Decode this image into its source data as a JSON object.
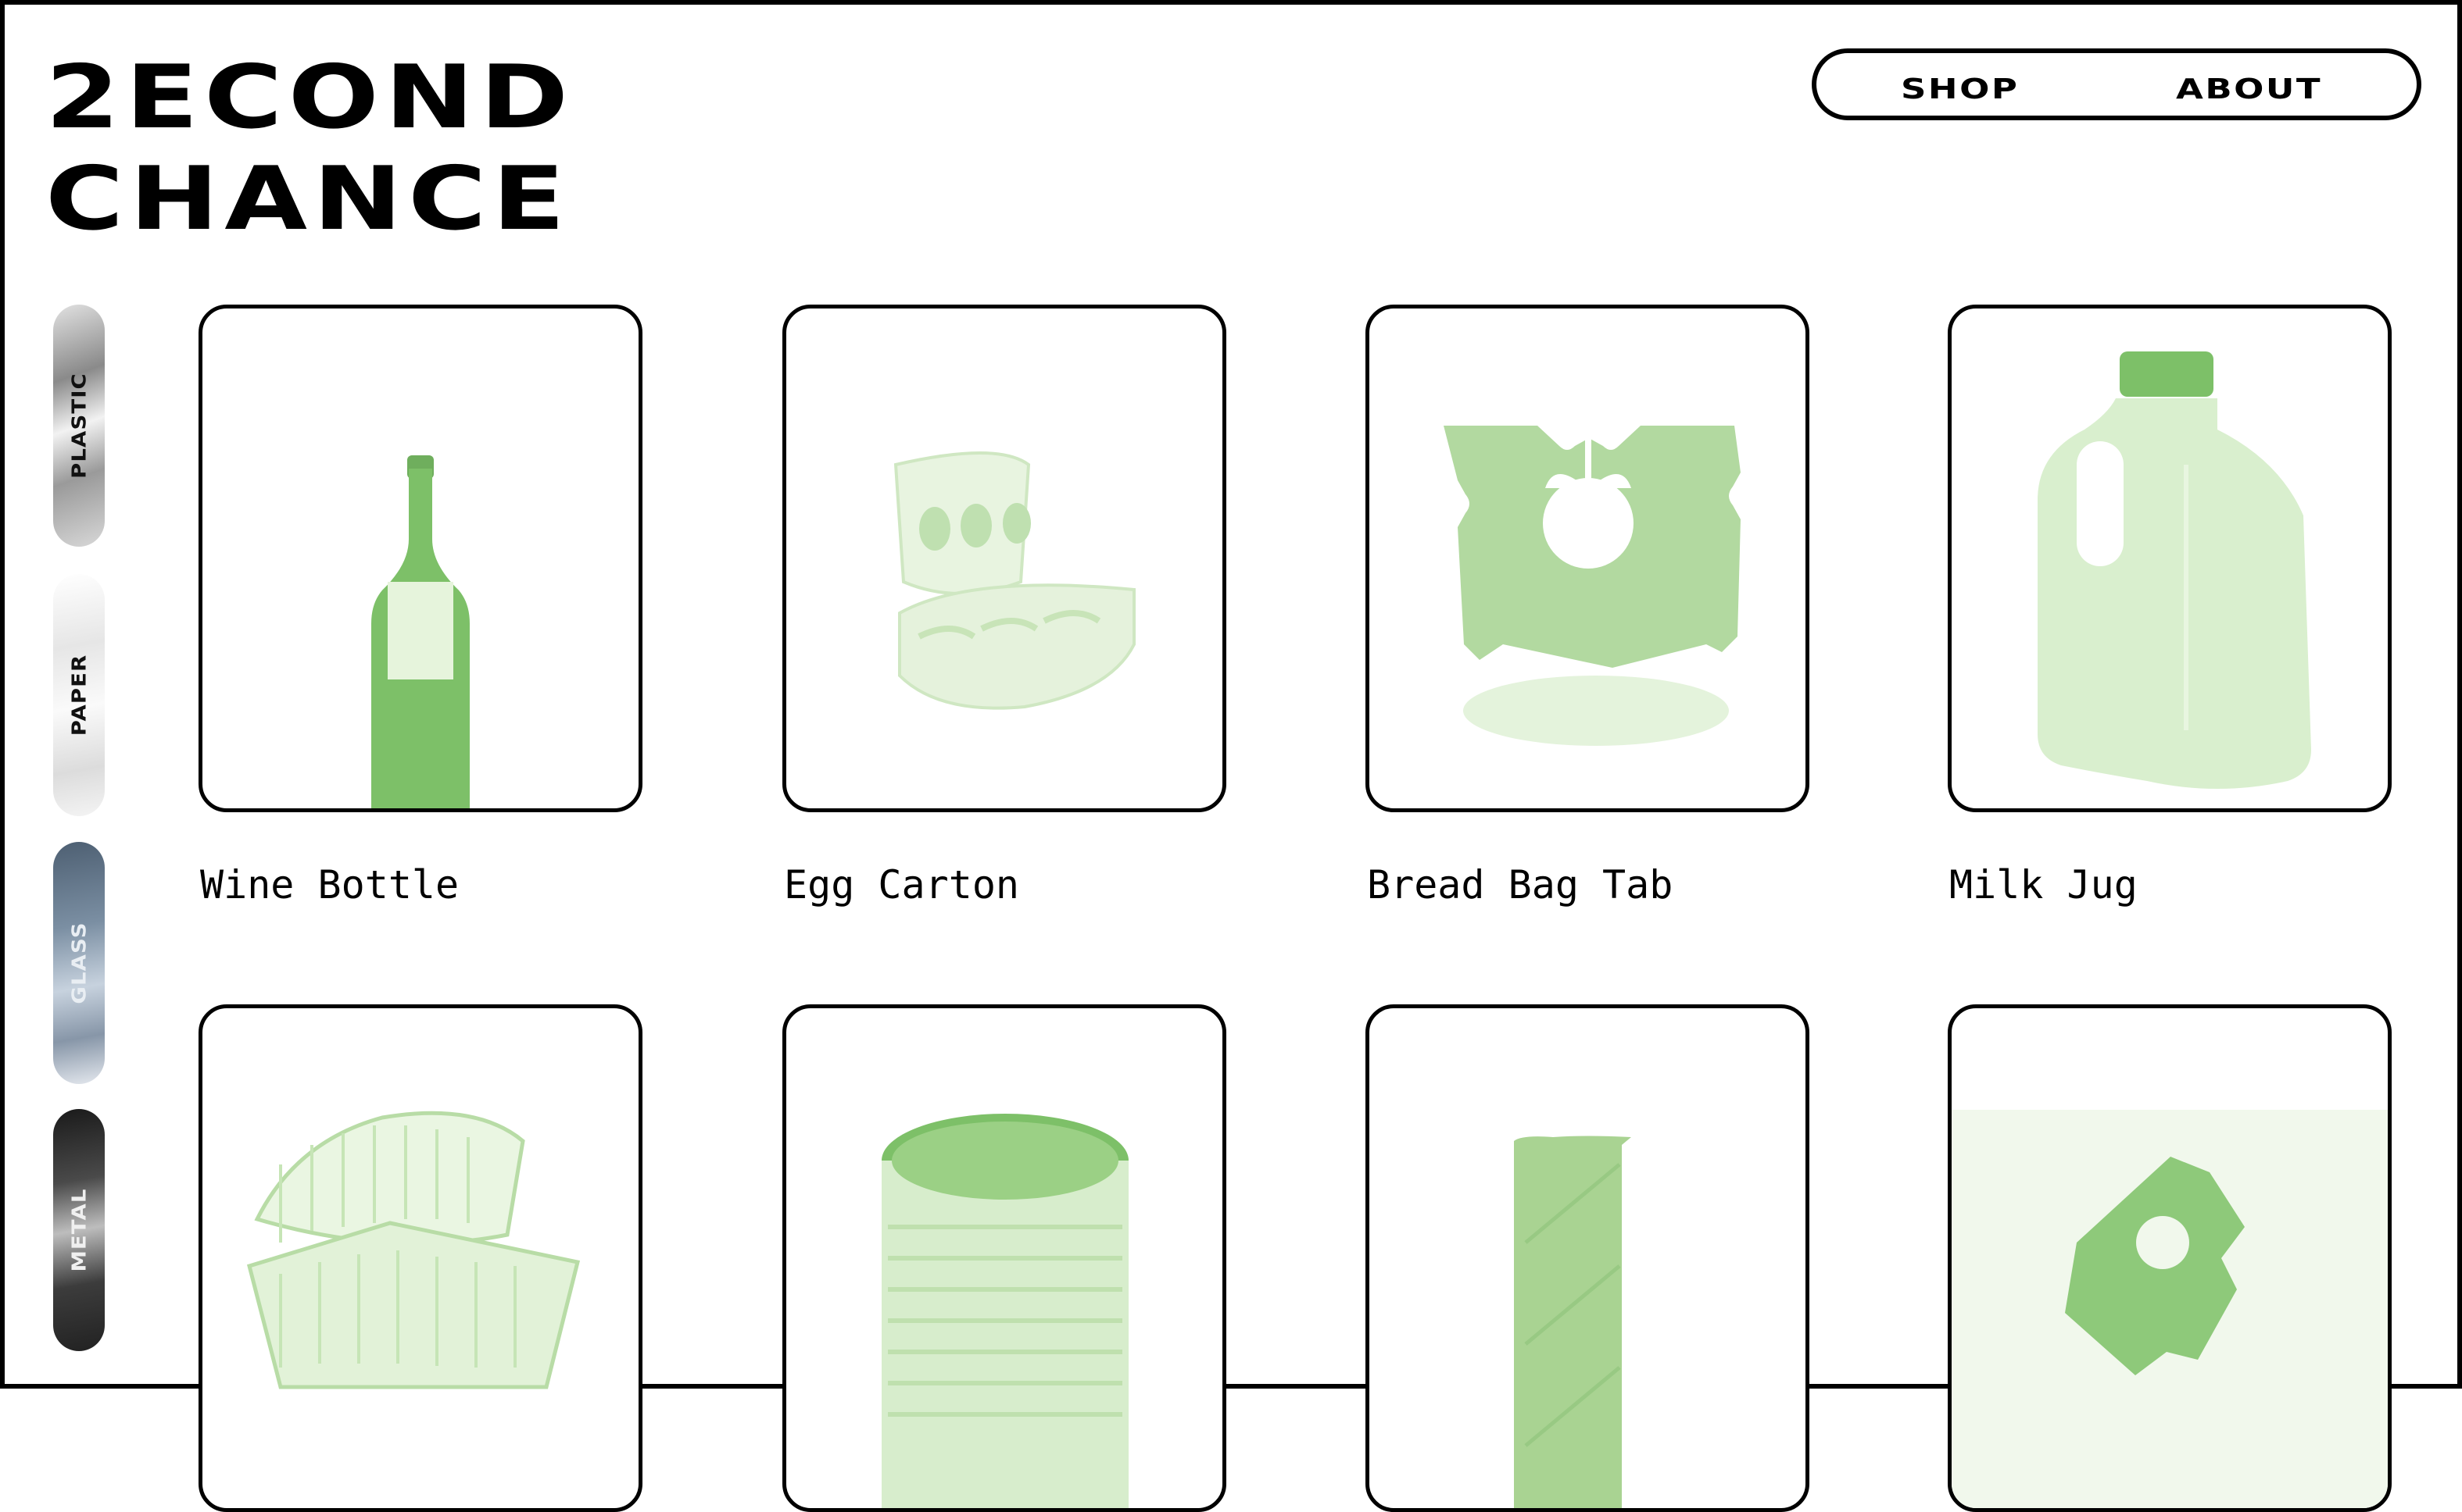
{
  "brand": {
    "line1": "2ECOND",
    "line2": "CHANCE"
  },
  "nav": {
    "shop": "SHOP",
    "about": "ABOUT"
  },
  "categories": [
    {
      "label": "PLASTIC"
    },
    {
      "label": "PAPER"
    },
    {
      "label": "GLASS"
    },
    {
      "label": "METAL"
    }
  ],
  "products": [
    {
      "name": "Wine Bottle",
      "icon": "wine-bottle"
    },
    {
      "name": "Egg Carton",
      "icon": "egg-carton"
    },
    {
      "name": "Bread Bag Tab",
      "icon": "bread-bag-tab"
    },
    {
      "name": "Milk Jug",
      "icon": "milk-jug"
    },
    {
      "name": "",
      "icon": "clamshell-container"
    },
    {
      "name": "",
      "icon": "tin-can"
    },
    {
      "name": "",
      "icon": "paper-tube"
    },
    {
      "name": "",
      "icon": "bread-bag-tab"
    }
  ],
  "colors": {
    "accent": "#7dc068",
    "accent_light": "#d2ecc4",
    "border": "#000000"
  }
}
